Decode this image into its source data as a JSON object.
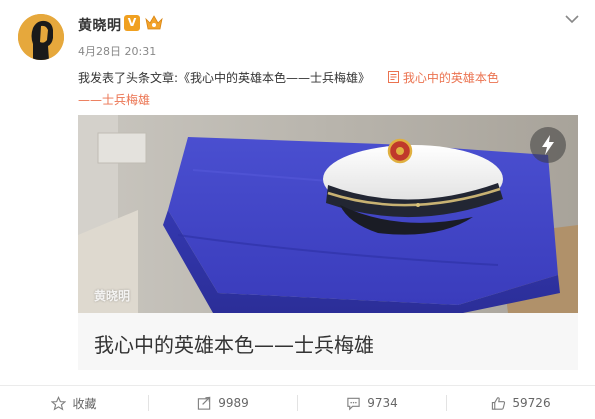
{
  "user": {
    "name": "黄晓明",
    "verified_badge": "V",
    "avatar_icon": "avatar-silhouette"
  },
  "post": {
    "time": "4月28日 20:31",
    "text": "我发表了头条文章:《我心中的英雄本色——士兵梅雄》",
    "link_text": "我心中的英雄本色",
    "link_text_cont": "——士兵梅雄"
  },
  "card": {
    "watermark": "黄晓明",
    "title": "我心中的英雄本色——士兵梅雄"
  },
  "actions": {
    "favorite_label": "收藏",
    "repost_count": "9989",
    "comment_count": "9734",
    "like_count": "59726"
  },
  "colors": {
    "link": "#eb7350",
    "badge": "#f0a020",
    "blanket": "#3b3fbf"
  }
}
